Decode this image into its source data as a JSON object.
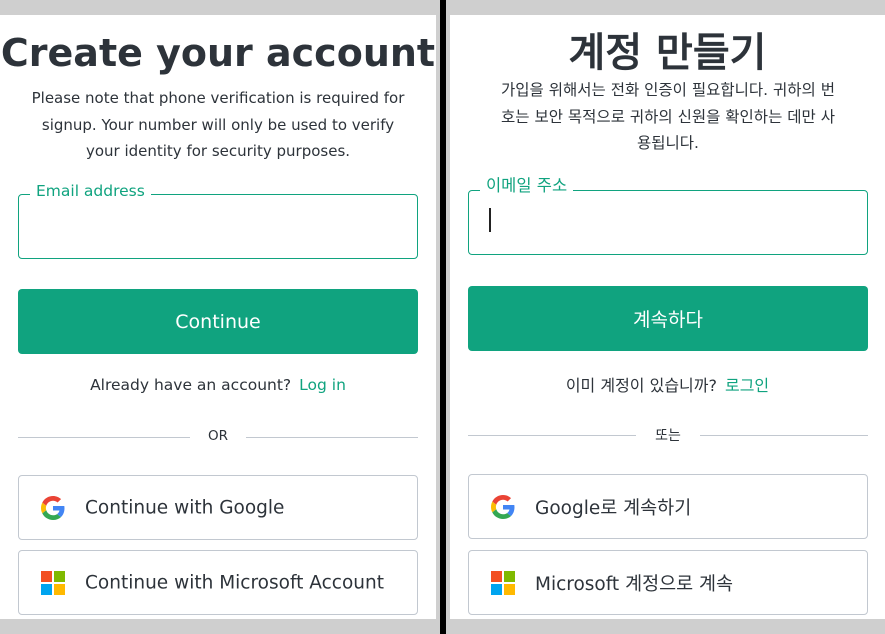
{
  "left": {
    "title": "Create your account",
    "description_lines": [
      "Please note that phone verification is required for",
      "signup. Your number will only be used to verify",
      "your identity for security purposes."
    ],
    "email_label": "Email address",
    "email_value": "",
    "continue_label": "Continue",
    "login_prompt": "Already have an account?",
    "login_link": "Log in",
    "or_text": "OR",
    "google_label": "Continue with Google",
    "microsoft_label": "Continue with Microsoft Account"
  },
  "right": {
    "title": "계정 만들기",
    "description_lines": [
      "가입을 위해서는 전화 인증이 필요합니다. 귀하의 번",
      "호는 보안 목적으로 귀하의 신원을 확인하는 데만 사",
      "용됩니다."
    ],
    "email_label": "이메일 주소",
    "email_value": "",
    "continue_label": "계속하다",
    "login_prompt": "이미 계정이 있습니까?",
    "login_link": "로그인",
    "or_text": "또는",
    "google_label": "Google로 계속하기",
    "microsoft_label": "Microsoft 계정으로 계속"
  },
  "colors": {
    "accent": "#10a37f",
    "text": "#2d333a",
    "border": "#c2c8d0",
    "google_blue": "#4285F4",
    "google_red": "#EA4335",
    "google_yellow": "#FBBC05",
    "google_green": "#34A853",
    "ms_red": "#F25022",
    "ms_green": "#7FBA00",
    "ms_blue": "#00A4EF",
    "ms_yellow": "#FFB900"
  },
  "icons": {
    "google": "google-g-icon",
    "microsoft": "microsoft-logo-icon"
  }
}
